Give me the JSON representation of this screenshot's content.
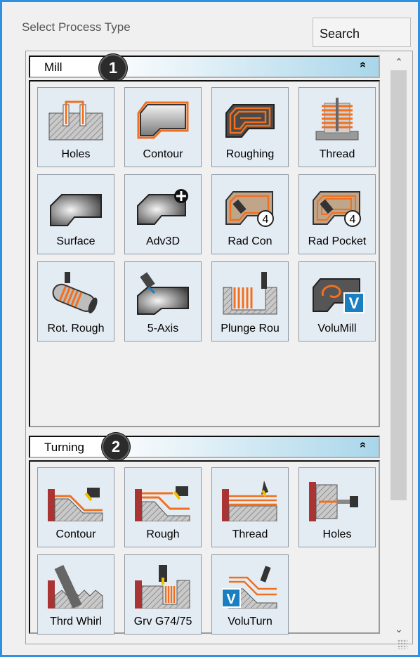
{
  "header": {
    "title": "Select Process Type",
    "search_label": "Search"
  },
  "mill": {
    "section_label": "Mill",
    "collapse_glyph": "»",
    "badge": "1",
    "tiles": [
      {
        "label": "Holes",
        "icon": "holes-icon"
      },
      {
        "label": "Contour",
        "icon": "contour-icon"
      },
      {
        "label": "Roughing",
        "icon": "roughing-icon"
      },
      {
        "label": "Thread",
        "icon": "thread-icon"
      },
      {
        "label": "Surface",
        "icon": "surface-icon"
      },
      {
        "label": "Adv3D",
        "icon": "adv3d-icon"
      },
      {
        "label": "Rad Con",
        "icon": "rad-con-icon",
        "overlay": "4"
      },
      {
        "label": "Rad Pocket",
        "icon": "rad-pocket-icon",
        "overlay": "4"
      },
      {
        "label": "Rot. Rough",
        "icon": "rot-rough-icon"
      },
      {
        "label": "5-Axis",
        "icon": "five-axis-icon"
      },
      {
        "label": "Plunge Rou",
        "icon": "plunge-rough-icon"
      },
      {
        "label": "VoluMill",
        "icon": "volumill-icon",
        "overlay": "V"
      }
    ]
  },
  "turning": {
    "section_label": "Turning",
    "collapse_glyph": "»",
    "badge": "2",
    "tiles": [
      {
        "label": "Contour",
        "icon": "turn-contour-icon"
      },
      {
        "label": "Rough",
        "icon": "turn-rough-icon"
      },
      {
        "label": "Thread",
        "icon": "turn-thread-icon"
      },
      {
        "label": "Holes",
        "icon": "turn-holes-icon"
      },
      {
        "label": "Thrd Whirl",
        "icon": "thread-whirl-icon"
      },
      {
        "label": "Grv G74/75",
        "icon": "groove-icon"
      },
      {
        "label": "VoluTurn",
        "icon": "voluturn-icon",
        "overlay": "V"
      }
    ]
  },
  "colors": {
    "accent_orange": "#f07020",
    "tile_bg": "#e4ecf3",
    "window_border": "#2f8fe0",
    "volumill_blue": "#1a7fc0"
  }
}
